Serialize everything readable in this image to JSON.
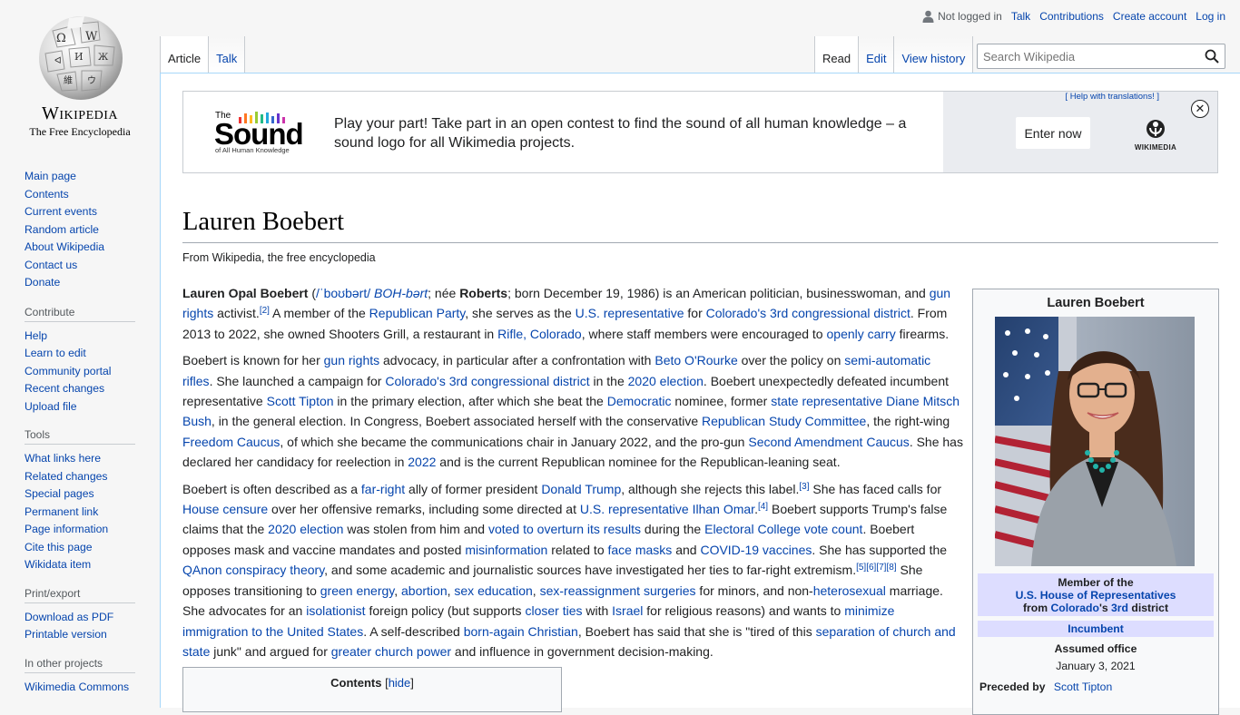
{
  "logo": {
    "wordmark": "Wikipedia",
    "tagline": "The Free Encyclopedia"
  },
  "sidebar": {
    "navigation": [
      "Main page",
      "Contents",
      "Current events",
      "Random article",
      "About Wikipedia",
      "Contact us",
      "Donate"
    ],
    "contribute": {
      "title": "Contribute",
      "items": [
        "Help",
        "Learn to edit",
        "Community portal",
        "Recent changes",
        "Upload file"
      ]
    },
    "tools": {
      "title": "Tools",
      "items": [
        "What links here",
        "Related changes",
        "Special pages",
        "Permanent link",
        "Page information",
        "Cite this page",
        "Wikidata item"
      ]
    },
    "print": {
      "title": "Print/export",
      "items": [
        "Download as PDF",
        "Printable version"
      ]
    },
    "other": {
      "title": "In other projects",
      "items": [
        "Wikimedia Commons"
      ]
    }
  },
  "personal": {
    "not_logged_in": "Not logged in",
    "talk": "Talk",
    "contributions": "Contributions",
    "create_account": "Create account",
    "login": "Log in"
  },
  "tabs": {
    "article": "Article",
    "talk": "Talk",
    "read": "Read",
    "edit": "Edit",
    "history": "View history"
  },
  "search": {
    "placeholder": "Search Wikipedia"
  },
  "banner": {
    "logo_the": "The",
    "logo_sound": "Sound",
    "logo_sub": "of All Human Knowledge",
    "message": "Play your part! Take part in an open contest to find the sound of all human knowledge – a sound logo for all Wikimedia projects.",
    "help": "[ Help with translations! ]",
    "enter": "Enter now",
    "wikimedia": "WIKIMEDIA",
    "close": "✕"
  },
  "article": {
    "title": "Lauren Boebert",
    "site_sub": "From Wikipedia, the free encyclopedia",
    "toc_title": "Contents",
    "toc_hide": "hide"
  },
  "infobox": {
    "name": "Lauren Boebert",
    "office_line1": "Member of the",
    "office_line2": "U.S. House of Representatives",
    "office_from": "from",
    "office_state": "Colorado",
    "office_apos": "'s",
    "office_district": "3rd",
    "office_end": "district",
    "incumbent": "Incumbent",
    "assumed": "Assumed office",
    "assumed_date": "January 3, 2021",
    "preceded_label": "Preceded by",
    "preceded_name": "Scott Tipton"
  },
  "colors": {
    "link": "#0645ad",
    "infobox_header": "#ddddff",
    "border": "#a2a9b1"
  }
}
